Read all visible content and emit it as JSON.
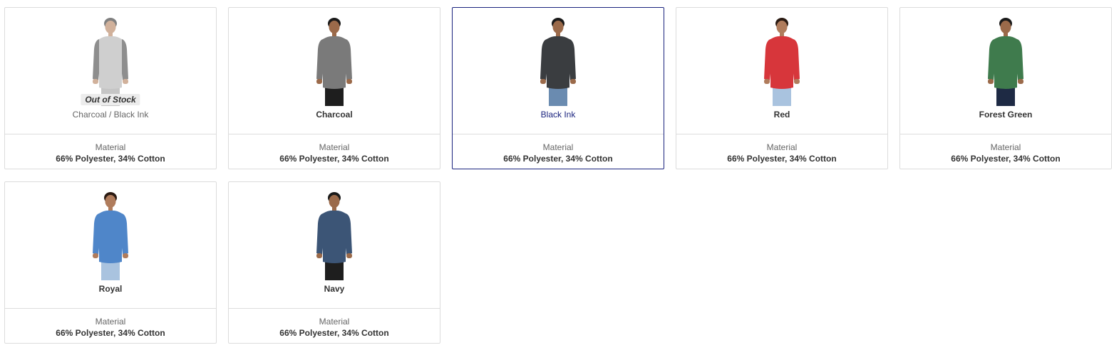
{
  "swatches": [
    {
      "color_name": "Charcoal / Black Ink",
      "badge": "Out of Stock",
      "material_label": "Material",
      "material_value": "66% Polyester, 34% Cotton",
      "shirt_color": "#8c8c8c",
      "sleeve_color": "#7b7b7b",
      "body_color": "#c7c7c7",
      "pants_color": "#bcbcbc",
      "skin_color": "#c9a48a",
      "hair_color": "#6b6b6b",
      "faded": true
    },
    {
      "color_name": "Charcoal",
      "material_label": "Material",
      "material_value": "66% Polyester, 34% Cotton",
      "shirt_color": "#7a7a7a",
      "sleeve_color": "#7a7a7a",
      "body_color": "#7a7a7a",
      "pants_color": "#1e1e1e",
      "skin_color": "#9b6a4a",
      "hair_color": "#1a1a1a"
    },
    {
      "color_name": "Black Ink",
      "selected": true,
      "material_label": "Material",
      "material_value": "66% Polyester, 34% Cotton",
      "shirt_color": "#3a3d40",
      "sleeve_color": "#3a3d40",
      "body_color": "#3a3d40",
      "pants_color": "#6a8bb0",
      "skin_color": "#9b6a4a",
      "hair_color": "#1a1a1a"
    },
    {
      "color_name": "Red",
      "material_label": "Material",
      "material_value": "66% Polyester, 34% Cotton",
      "shirt_color": "#d7363b",
      "sleeve_color": "#d7363b",
      "body_color": "#d7363b",
      "pants_color": "#a9c3df",
      "skin_color": "#b07c5c",
      "hair_color": "#2a1a12"
    },
    {
      "color_name": "Forest Green",
      "material_label": "Material",
      "material_value": "66% Polyester, 34% Cotton",
      "shirt_color": "#3f7b4d",
      "sleeve_color": "#3f7b4d",
      "body_color": "#3f7b4d",
      "pants_color": "#1e2a44",
      "skin_color": "#9b6a4a",
      "hair_color": "#1a1a1a"
    },
    {
      "color_name": "Royal",
      "material_label": "Material",
      "material_value": "66% Polyester, 34% Cotton",
      "shirt_color": "#4f86c9",
      "sleeve_color": "#4f86c9",
      "body_color": "#4f86c9",
      "pants_color": "#a9c3df",
      "skin_color": "#b07c5c",
      "hair_color": "#2a1a12"
    },
    {
      "color_name": "Navy",
      "material_label": "Material",
      "material_value": "66% Polyester, 34% Cotton",
      "shirt_color": "#3c5576",
      "sleeve_color": "#3c5576",
      "body_color": "#3c5576",
      "pants_color": "#1e1e1e",
      "skin_color": "#9b6a4a",
      "hair_color": "#1a1a1a"
    }
  ]
}
